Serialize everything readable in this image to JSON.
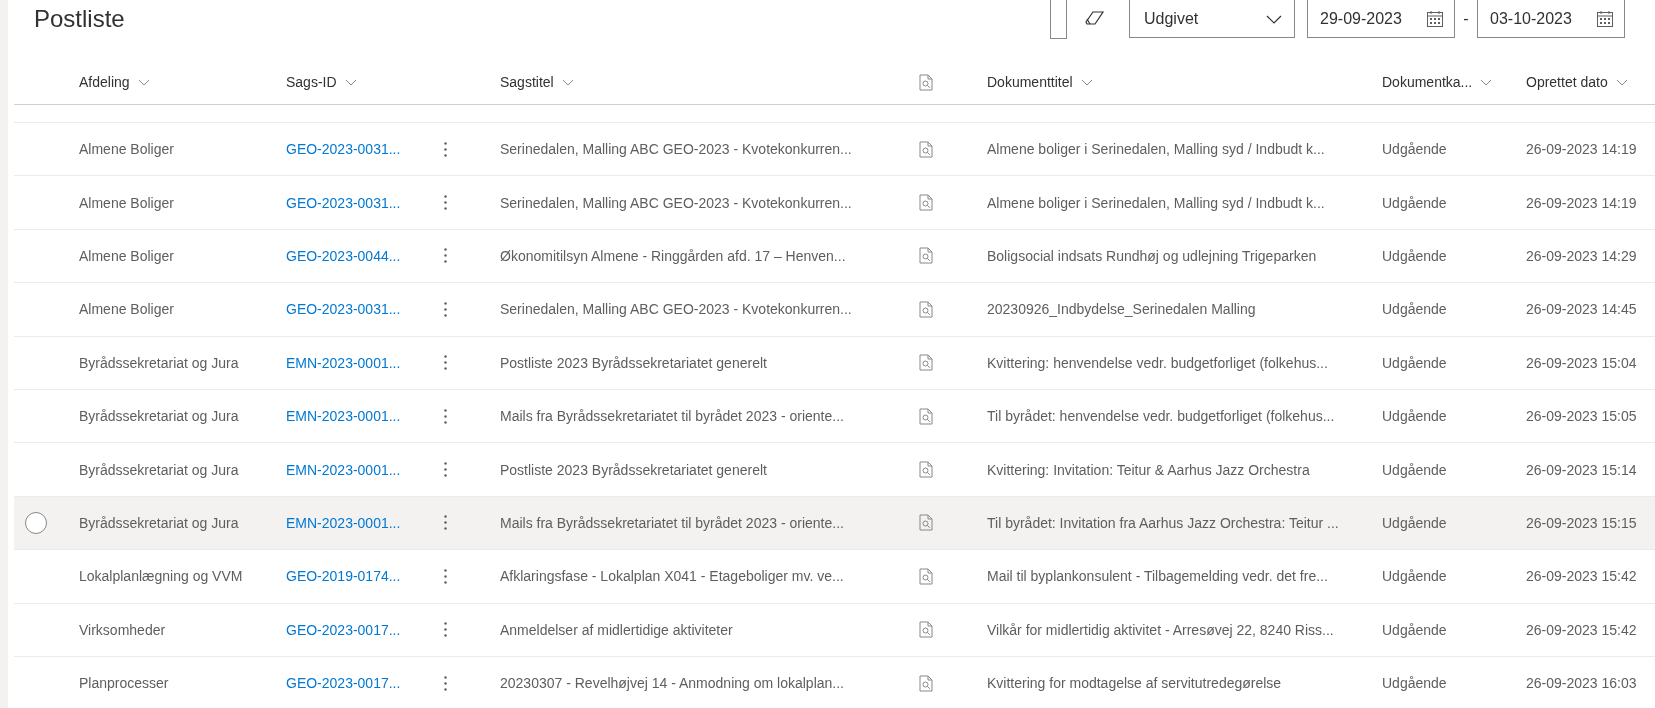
{
  "page": {
    "title": "Postliste"
  },
  "filters": {
    "date_type": "Udgivet",
    "date_from": "29-09-2023",
    "separator": "-",
    "date_to": "03-10-2023"
  },
  "table": {
    "columns": [
      {
        "label": "Afdeling",
        "sortable": true
      },
      {
        "label": "Sags-ID",
        "sortable": true
      },
      {
        "label": "Sagstitel",
        "sortable": true
      },
      {
        "label": "Dokumenttitel",
        "sortable": true
      },
      {
        "label": "Dokumentka...",
        "sortable": true
      },
      {
        "label": "Oprettet dato",
        "sortable": true
      }
    ],
    "rows": [
      {
        "afdeling": "Almene Boliger",
        "sags_id": "GEO-2023-0031...",
        "sagstitel": "Serinedalen, Malling ABC GEO-2023 - Kvotekonkurren...",
        "dokumenttitel": "Almene boliger i Serinedalen, Malling syd / Indbudt k...",
        "kategori": "Udgående",
        "oprettet": "26-09-2023 14:19",
        "hovered": false
      },
      {
        "afdeling": "Almene Boliger",
        "sags_id": "GEO-2023-0031...",
        "sagstitel": "Serinedalen, Malling ABC GEO-2023 - Kvotekonkurren...",
        "dokumenttitel": "Almene boliger i Serinedalen, Malling syd / Indbudt k...",
        "kategori": "Udgående",
        "oprettet": "26-09-2023 14:19",
        "hovered": false
      },
      {
        "afdeling": "Almene Boliger",
        "sags_id": "GEO-2023-0044...",
        "sagstitel": "Økonomitilsyn Almene - Ringgården afd. 17 – Henven...",
        "dokumenttitel": "Boligsocial indsats Rundhøj og udlejning Trigeparken",
        "kategori": "Udgående",
        "oprettet": "26-09-2023 14:29",
        "hovered": false
      },
      {
        "afdeling": "Almene Boliger",
        "sags_id": "GEO-2023-0031...",
        "sagstitel": "Serinedalen, Malling ABC GEO-2023 - Kvotekonkurren...",
        "dokumenttitel": "20230926_Indbydelse_Serinedalen Malling",
        "kategori": "Udgående",
        "oprettet": "26-09-2023 14:45",
        "hovered": false
      },
      {
        "afdeling": "Byrådssekretariat og Jura",
        "sags_id": "EMN-2023-0001...",
        "sagstitel": "Postliste 2023 Byrådssekretariatet generelt",
        "dokumenttitel": "Kvittering: henvendelse vedr. budgetforliget (folkehus...",
        "kategori": "Udgående",
        "oprettet": "26-09-2023 15:04",
        "hovered": false
      },
      {
        "afdeling": "Byrådssekretariat og Jura",
        "sags_id": "EMN-2023-0001...",
        "sagstitel": "Mails fra Byrådssekretariatet til byrådet 2023 - oriente...",
        "dokumenttitel": "Til byrådet: henvendelse vedr. budgetforliget (folkehus...",
        "kategori": "Udgående",
        "oprettet": "26-09-2023 15:05",
        "hovered": false
      },
      {
        "afdeling": "Byrådssekretariat og Jura",
        "sags_id": "EMN-2023-0001...",
        "sagstitel": "Postliste 2023 Byrådssekretariatet generelt",
        "dokumenttitel": "Kvittering: Invitation: Teitur & Aarhus Jazz Orchestra",
        "kategori": "Udgående",
        "oprettet": "26-09-2023 15:14",
        "hovered": false
      },
      {
        "afdeling": "Byrådssekretariat og Jura",
        "sags_id": "EMN-2023-0001...",
        "sagstitel": "Mails fra Byrådssekretariatet til byrådet 2023 - oriente...",
        "dokumenttitel": "Til byrådet: Invitation fra Aarhus Jazz Orchestra: Teitur ...",
        "kategori": "Udgående",
        "oprettet": "26-09-2023 15:15",
        "hovered": true
      },
      {
        "afdeling": "Lokalplanlægning og VVM",
        "sags_id": "GEO-2019-0174...",
        "sagstitel": "Afklaringsfase - Lokalplan X041 - Etageboliger mv. ve...",
        "dokumenttitel": "Mail til byplankonsulent - Tilbagemelding vedr. det fre...",
        "kategori": "Udgående",
        "oprettet": "26-09-2023 15:42",
        "hovered": false
      },
      {
        "afdeling": "Virksomheder",
        "sags_id": "GEO-2023-0017...",
        "sagstitel": "Anmeldelser af midlertidige aktiviteter",
        "dokumenttitel": "Vilkår for midlertidig aktivitet - Arresøvej 22, 8240 Riss...",
        "kategori": "Udgående",
        "oprettet": "26-09-2023 15:42",
        "hovered": false
      },
      {
        "afdeling": "Planprocesser",
        "sags_id": "GEO-2023-0017...",
        "sagstitel": "20230307 - Revelhøjvej 14 - Anmodning om lokalplan...",
        "dokumenttitel": "Kvittering for modtagelse af servitutredegørelse",
        "kategori": "Udgående",
        "oprettet": "26-09-2023 16:03",
        "hovered": false
      }
    ]
  }
}
